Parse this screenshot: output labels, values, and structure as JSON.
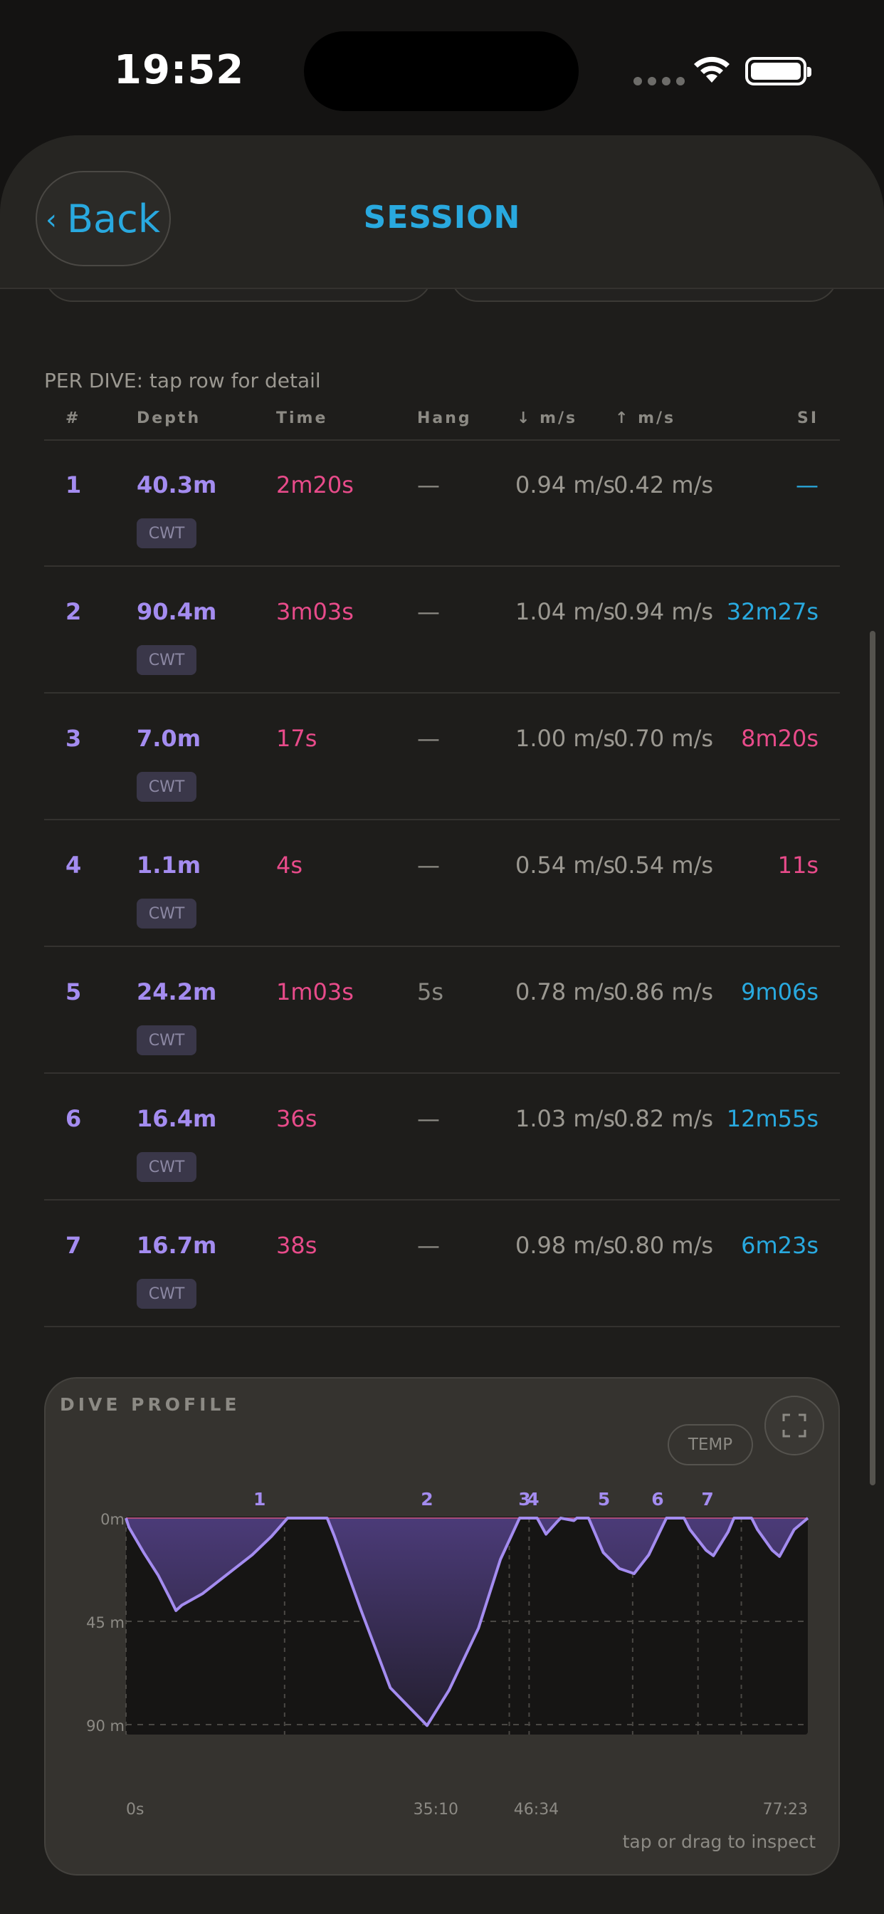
{
  "status": {
    "time": "19:52"
  },
  "nav": {
    "back_label": "Back",
    "title": "SESSION"
  },
  "table": {
    "caption": "PER DIVE: tap row for detail",
    "headers": [
      "#",
      "Depth",
      "Time",
      "Hang",
      "↓ m/s",
      "↑ m/s",
      "SI"
    ],
    "rows": [
      {
        "num": "1",
        "depth": "40.3m",
        "time": "2m20s",
        "hang": "—",
        "down": "0.94 m/s",
        "up": "0.42 m/s",
        "si": "—",
        "si_color": "#29a9df",
        "badge": "CWT"
      },
      {
        "num": "2",
        "depth": "90.4m",
        "time": "3m03s",
        "hang": "—",
        "down": "1.04 m/s",
        "up": "0.94 m/s",
        "si": "32m27s",
        "si_color": "#29a9df",
        "badge": "CWT"
      },
      {
        "num": "3",
        "depth": "7.0m",
        "time": "17s",
        "hang": "—",
        "down": "1.00 m/s",
        "up": "0.70 m/s",
        "si": "8m20s",
        "si_color": "#e84b8a",
        "badge": "CWT"
      },
      {
        "num": "4",
        "depth": "1.1m",
        "time": "4s",
        "hang": "—",
        "down": "0.54 m/s",
        "up": "0.54 m/s",
        "si": "11s",
        "si_color": "#e84b8a",
        "badge": "CWT"
      },
      {
        "num": "5",
        "depth": "24.2m",
        "time": "1m03s",
        "hang": "5s",
        "down": "0.78 m/s",
        "up": "0.86 m/s",
        "si": "9m06s",
        "si_color": "#29a9df",
        "badge": "CWT"
      },
      {
        "num": "6",
        "depth": "16.4m",
        "time": "36s",
        "hang": "—",
        "down": "1.03 m/s",
        "up": "0.82 m/s",
        "si": "12m55s",
        "si_color": "#29a9df",
        "badge": "CWT"
      },
      {
        "num": "7",
        "depth": "16.7m",
        "time": "38s",
        "hang": "—",
        "down": "0.98 m/s",
        "up": "0.80 m/s",
        "si": "6m23s",
        "si_color": "#29a9df",
        "badge": "CWT"
      }
    ]
  },
  "profile": {
    "title": "DIVE PROFILE",
    "temp_label": "TEMP",
    "hint": "tap or drag to inspect"
  },
  "chart_data": {
    "type": "area",
    "y_ticks": [
      "0m",
      "45 m",
      "90 m"
    ],
    "x_ticks": [
      "0s",
      "35:10",
      "46:34",
      "77:23"
    ],
    "x_tick_seconds": [
      0,
      2110,
      2794,
      4643
    ],
    "ylim": [
      0,
      95
    ],
    "xlim": [
      0,
      4643
    ],
    "dive_labels": [
      "1",
      "2",
      "3",
      "4",
      "5",
      "6",
      "7"
    ],
    "dive_marker_seconds": [
      910,
      2050,
      2714,
      2772,
      3255,
      3620,
      3960
    ],
    "dive_starts_seconds": [
      0,
      1080,
      2610,
      2745,
      3450,
      3895,
      4190
    ],
    "depth_profile": [
      [
        0,
        0
      ],
      [
        20,
        4
      ],
      [
        120,
        15
      ],
      [
        220,
        25
      ],
      [
        300,
        35
      ],
      [
        340,
        40.3
      ],
      [
        380,
        38
      ],
      [
        520,
        33
      ],
      [
        700,
        24
      ],
      [
        860,
        16
      ],
      [
        990,
        8
      ],
      [
        1100,
        0
      ],
      [
        1370,
        0
      ],
      [
        1420,
        8
      ],
      [
        1600,
        40
      ],
      [
        1800,
        74
      ],
      [
        2050,
        90.4
      ],
      [
        2200,
        75
      ],
      [
        2400,
        48
      ],
      [
        2550,
        18
      ],
      [
        2680,
        0
      ],
      [
        2800,
        0
      ],
      [
        2860,
        7
      ],
      [
        2930,
        2
      ],
      [
        2960,
        0
      ],
      [
        3050,
        1.1
      ],
      [
        3070,
        0
      ],
      [
        3150,
        0
      ],
      [
        3250,
        15
      ],
      [
        3360,
        22
      ],
      [
        3460,
        24.2
      ],
      [
        3560,
        16
      ],
      [
        3680,
        0
      ],
      [
        3800,
        0
      ],
      [
        3840,
        5
      ],
      [
        3950,
        14
      ],
      [
        4000,
        16.4
      ],
      [
        4100,
        6
      ],
      [
        4140,
        0
      ],
      [
        4260,
        0
      ],
      [
        4300,
        5
      ],
      [
        4400,
        14
      ],
      [
        4450,
        16.7
      ],
      [
        4550,
        5
      ],
      [
        4643,
        0
      ]
    ]
  }
}
